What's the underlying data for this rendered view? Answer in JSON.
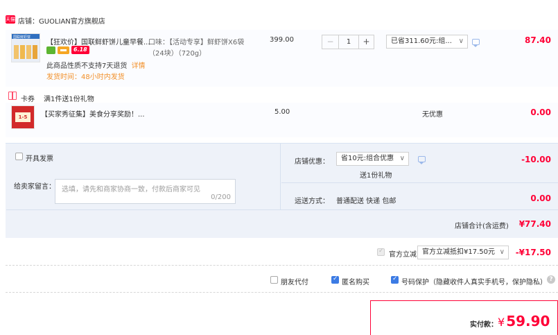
{
  "shop": {
    "prefix": "店铺：",
    "name": "GUOLIAN官方旗舰店",
    "badge": "天猫"
  },
  "item": {
    "thumb_text": "国联鲜虾饼",
    "title": "【狂欢价】国联鲜虾饼儿童早餐...",
    "tag_618": "6.18",
    "notice": "此商品性质不支持7天退货",
    "notice_link": "详情",
    "ship": "发货时间：48小时内发货",
    "flavor_line1": "口味：【活动专享】鲜虾饼X6袋",
    "flavor_line2": "（24块）（720g）",
    "price": "399.00",
    "qty": "1",
    "qty_minus": "−",
    "qty_plus": "+",
    "promo": "已省311.60元:组...",
    "subtotal": "87.40"
  },
  "gift": {
    "tag": "卡券",
    "desc": "满1件送1份礼物",
    "thumb_text": "1-5",
    "title": "【买家秀征集】美食分享奖励！...",
    "price": "5.00",
    "discount": "无优惠",
    "subtotal": "0.00"
  },
  "invoice_label": "开具发票",
  "message": {
    "label": "给卖家留言：",
    "placeholder": "选填，请先和商家协商一致，付款后商家可见",
    "count": "0/200"
  },
  "shop_discount": {
    "label": "店铺优惠：",
    "select": "省10元:组合优惠",
    "sub": "送1份礼物",
    "amount": "-10.00"
  },
  "shipping": {
    "label": "运送方式：",
    "value": "普通配送 快递 包邮",
    "amount": "0.00"
  },
  "shop_total": {
    "label": "店铺合计(含运费)",
    "amount": "¥77.40"
  },
  "instant": {
    "label": "官方立减",
    "select": "官方立减抵扣¥17.50元",
    "amount": "-¥17.50"
  },
  "options": {
    "friend_pay": "朋友代付",
    "anonymous": "匿名购买",
    "privacy": "号码保护（隐藏收件人真实手机号，保护隐私）",
    "help": "?"
  },
  "pay": {
    "label": "实付款：",
    "currency": "¥",
    "amount": "59.90"
  },
  "colors": {
    "accent": "#ff0036",
    "checkbox": "#3c7be4",
    "panel": "#eef2f9"
  }
}
